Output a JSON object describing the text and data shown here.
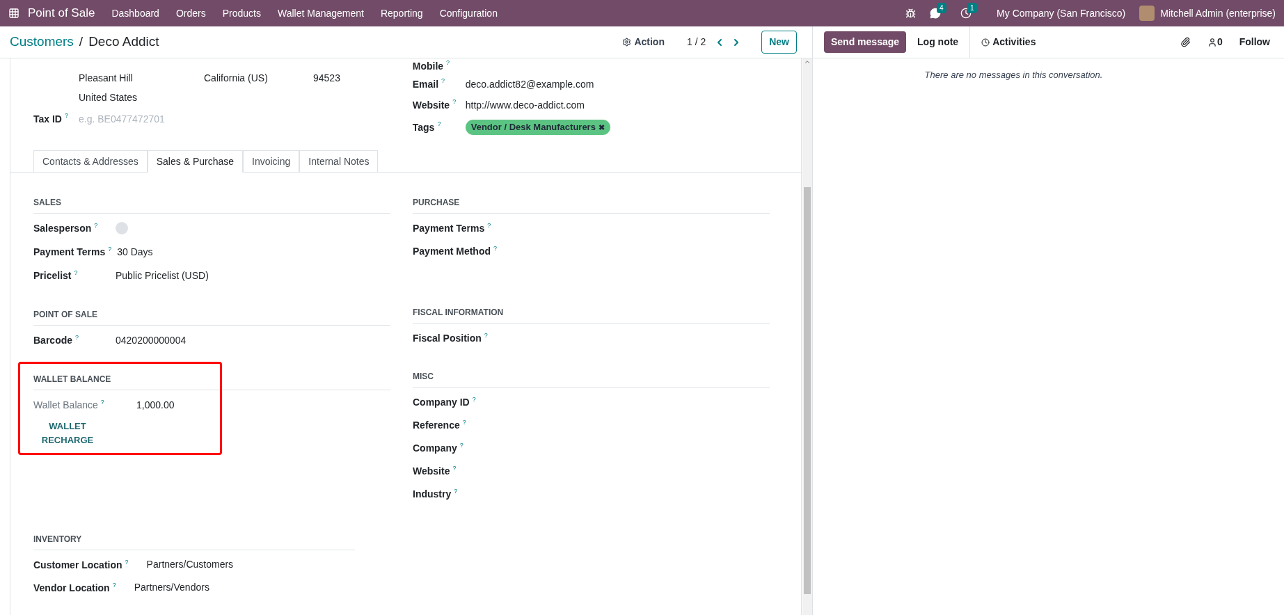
{
  "navbar": {
    "app_name": "Point of Sale",
    "menu": [
      "Dashboard",
      "Orders",
      "Products",
      "Wallet Management",
      "Reporting",
      "Configuration"
    ],
    "messages_badge": "4",
    "activities_badge": "1",
    "company": "My Company (San Francisco)",
    "user": "Mitchell Admin (enterprise)"
  },
  "breadcrumb": {
    "parent": "Customers",
    "separator": "/",
    "current": "Deco Addict"
  },
  "control": {
    "action": "Action",
    "pager": "1 / 2",
    "new_button": "New"
  },
  "address": {
    "city": "Pleasant Hill",
    "state": "California (US)",
    "zip": "94523",
    "country": "United States",
    "tax_id": {
      "label": "Tax ID",
      "hint": "?",
      "placeholder": "e.g. BE0477472701"
    }
  },
  "contact_fields": [
    {
      "label": "Mobile",
      "hint": "?"
    },
    {
      "label": "Email",
      "hint": "?",
      "value": "deco.addict82@example.com"
    },
    {
      "label": "Website",
      "hint": "?",
      "value": "http://www.deco-addict.com"
    }
  ],
  "tags": {
    "label": "Tags",
    "hint": "?",
    "items": [
      {
        "text": "Vendor / Desk Manufacturers",
        "remove": "✖",
        "color": "#5cc482"
      }
    ]
  },
  "tabs": [
    {
      "label": "Contacts & Addresses",
      "selected": false
    },
    {
      "label": "Sales & Purchase",
      "selected": true
    },
    {
      "label": "Invoicing",
      "selected": false
    },
    {
      "label": "Internal Notes",
      "selected": false
    }
  ],
  "left_sections": [
    {
      "title": "SALES",
      "highlighted": false,
      "fields": [
        {
          "kind": "avatar",
          "label": "Salesperson",
          "hint": "?"
        },
        {
          "kind": "text",
          "label": "Payment Terms",
          "hint": "?",
          "value": "30 Days"
        },
        {
          "kind": "text",
          "label": "Pricelist",
          "hint": "?",
          "value": "Public Pricelist (USD)"
        }
      ]
    },
    {
      "title": "POINT OF SALE",
      "highlighted": false,
      "fields": [
        {
          "kind": "text",
          "label": "Barcode",
          "hint": "?",
          "value": "0420200000004"
        }
      ]
    },
    {
      "title": "WALLET BALANCE",
      "highlighted": true,
      "fields": [
        {
          "kind": "readonly",
          "label": "Wallet Balance",
          "hint": "?",
          "value": "1,000.00"
        },
        {
          "kind": "button",
          "label": "WALLET RECHARGE"
        }
      ]
    }
  ],
  "right_sections": [
    {
      "title": "PURCHASE",
      "fields": [
        {
          "label": "Payment Terms",
          "hint": "?"
        },
        {
          "label": "Payment Method",
          "hint": "?"
        }
      ]
    },
    {
      "title": "FISCAL INFORMATION",
      "fields": [
        {
          "label": "Fiscal Position",
          "hint": "?"
        }
      ]
    },
    {
      "title": "MISC",
      "fields": [
        {
          "label": "Company ID",
          "hint": "?"
        },
        {
          "label": "Reference",
          "hint": "?"
        },
        {
          "label": "Company",
          "hint": "?"
        },
        {
          "label": "Website",
          "hint": "?"
        },
        {
          "label": "Industry",
          "hint": "?"
        }
      ]
    }
  ],
  "inventory": {
    "title": "INVENTORY",
    "fields": [
      {
        "label": "Customer Location",
        "hint": "?",
        "value": "Partners/Customers"
      },
      {
        "label": "Vendor Location",
        "hint": "?",
        "value": "Partners/Vendors"
      }
    ]
  },
  "chatter": {
    "send_message": "Send message",
    "log_note": "Log note",
    "activities": "Activities",
    "followers_count": "0",
    "follow": "Follow",
    "empty_text": "There are no messages in this conversation."
  }
}
